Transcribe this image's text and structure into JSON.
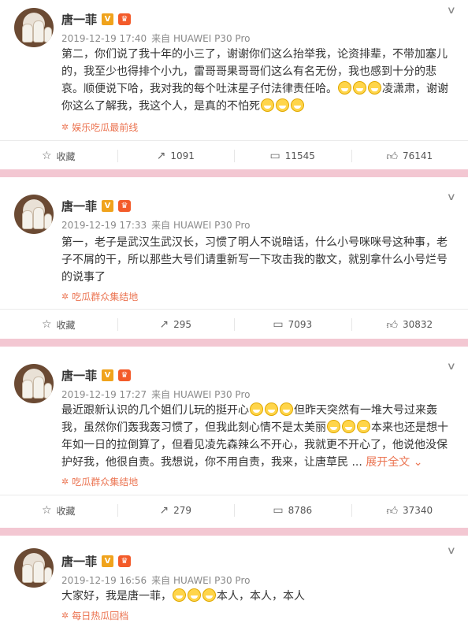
{
  "posts": [
    {
      "name": "唐一菲",
      "badge_v": "V",
      "time": "2019-12-19 17:40",
      "source": "来自 HUAWEI P30 Pro",
      "lines": [
        "第二，你们说了我十年的小三了，谢谢你们这么抬举我，论资排辈，不带加塞儿",
        "的，我至少也得排个小九，雷哥哥果哥哥们这么有名无份，我也感到十分的悲",
        "哀。顺便说下哈，我对我的每个吐沫星子付法律责任哈。",
        "你这么了解我，我这个人，是真的不怕死"
      ],
      "line3_suffix": "凌潇肃，谢谢",
      "topic": "娱乐吃瓜最前线",
      "actions": {
        "collect": "收藏",
        "forward": "1091",
        "comment": "11545",
        "like": "76141"
      }
    },
    {
      "name": "唐一菲",
      "badge_v": "V",
      "time": "2019-12-19 17:33",
      "source": "来自 HUAWEI P30 Pro",
      "lines": [
        "第一，老子是武汉生武汉长，习惯了明人不说暗话，什么小号咪咪号这种事，老",
        "子不屑的干，所以那些大号们请重新写一下攻击我的散文，就别拿什么小号烂号",
        "的说事了"
      ],
      "topic": "吃瓜群众集结地",
      "actions": {
        "collect": "收藏",
        "forward": "295",
        "comment": "7093",
        "like": "30832"
      }
    },
    {
      "name": "唐一菲",
      "badge_v": "V",
      "time": "2019-12-19 17:27",
      "source": "来自 HUAWEI P30 Pro",
      "lines": [
        "最近跟新认识的几个姐们儿玩的挺开心",
        "但昨天突然有一堆大号过来轰",
        "我，虽然你们轰我轰习惯了，但我此刻心情不是太美丽",
        "本来也还是想十",
        "年如一日的拉倒算了，但看见凌先森辣么不开心，我就更不开心了，他说他没保",
        "护好我，他很自责。我想说，你不用自责，我来，让唐草民 ..."
      ],
      "more": "展开全文",
      "topic": "吃瓜群众集结地",
      "actions": {
        "collect": "收藏",
        "forward": "279",
        "comment": "8786",
        "like": "37340"
      }
    },
    {
      "name": "唐一菲",
      "badge_v": "V",
      "time": "2019-12-19 16:56",
      "source": "来自 HUAWEI P30 Pro",
      "lines": [
        "大家好，我是唐一菲，",
        "本人，本人，本人"
      ],
      "topic": "每日热瓜回档"
    }
  ],
  "icons": {
    "chevron": "chevron-down-icon",
    "collect": "star-icon",
    "forward": "forward-icon",
    "comment": "comment-icon",
    "like": "thumb-up-icon"
  },
  "colors": {
    "divider": "#f3c7d2",
    "accent": "#eb7350",
    "vip": "#f0a31c"
  }
}
